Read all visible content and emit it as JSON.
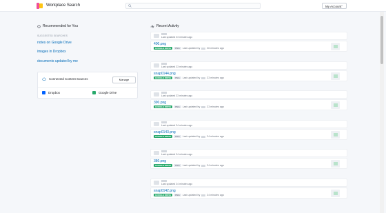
{
  "header": {
    "app_title": "Workplace Search",
    "account_label": "My Account"
  },
  "recommended": {
    "heading": "Recommended for You",
    "suggested_label": "SUGGESTED SEARCHES",
    "suggestions": [
      "notes on Google Drive",
      "images in Dropbox",
      "documents updated by me"
    ]
  },
  "sources": {
    "heading": "Connected Content Sources",
    "manage_label": "Manage",
    "items": [
      {
        "name": "Dropbox",
        "color": "#0061ff"
      },
      {
        "name": "Google Drive",
        "color": "#27a96b"
      }
    ]
  },
  "activity": {
    "heading": "Recent Activity",
    "items": [
      {
        "head_time": "Last updated 23 minutes ago",
        "title": "400.png",
        "source": "GOOGLE DRIVE",
        "type": "PNG",
        "updated_prefix": "Last updated by",
        "updated_suffix": "26 minutes ago"
      },
      {
        "head_time": "Last updated 23 minutes ago",
        "title": "snap0144.png",
        "source": "GOOGLE DRIVE",
        "type": "PNG",
        "updated_prefix": "Last updated by",
        "updated_suffix": "23 minutes ago"
      },
      {
        "head_time": "Last updated 23 minutes ago",
        "title": "390.png",
        "source": "GOOGLE DRIVE",
        "type": "PNG",
        "updated_prefix": "Last updated by",
        "updated_suffix": "23 minutes ago"
      },
      {
        "head_time": "Last updated 24 minutes ago",
        "title": "snap0143.png",
        "source": "GOOGLE DRIVE",
        "type": "PNG",
        "updated_prefix": "Last updated by",
        "updated_suffix": "24 minutes ago"
      },
      {
        "head_time": "Last updated 24 minutes ago",
        "title": "380.png",
        "source": "GOOGLE DRIVE",
        "type": "PNG",
        "updated_prefix": "Last updated by",
        "updated_suffix": "24 minutes ago"
      },
      {
        "head_time": "Last updated 24 minutes ago",
        "title": "snap0142.png",
        "source": "GOOGLE DRIVE",
        "type": "PNG",
        "updated_prefix": "Last updated by",
        "updated_suffix": "24 minutes ago"
      }
    ]
  }
}
